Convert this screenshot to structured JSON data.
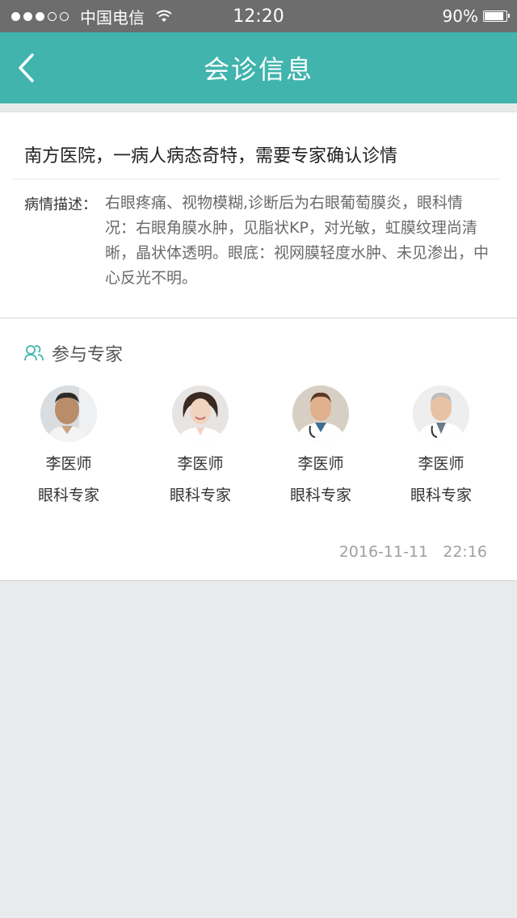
{
  "status_bar": {
    "carrier": "中国电信",
    "time": "12:20",
    "battery": "90%",
    "battery_level": 0.9
  },
  "header": {
    "title": "会诊信息",
    "back_icon": "chevron-left-icon"
  },
  "case": {
    "title": "南方医院，一病人病态奇特，需要专家确认诊情",
    "description_label": "病情描述：",
    "description": "右眼疼痛、视物模糊,诊断后为右眼葡萄膜炎，眼科情况：右眼角膜水肿，见脂状KP，对光敏，虹膜纹理尚清晰，晶状体透明。眼底：视网膜轻度水肿、未见渗出，中心反光不明。"
  },
  "experts": {
    "title": "参与专家",
    "icon": "people-icon",
    "list": [
      {
        "name": "李医师",
        "role": "眼科专家"
      },
      {
        "name": "李医师",
        "role": "眼科专家"
      },
      {
        "name": "李医师",
        "role": "眼科专家"
      },
      {
        "name": "李医师",
        "role": "眼科专家"
      }
    ]
  },
  "timestamp": "2016-11-11   22:16",
  "colors": {
    "accent": "#40b4ad",
    "status_bar": "#6d6d6d",
    "background": "#e8ebec"
  }
}
